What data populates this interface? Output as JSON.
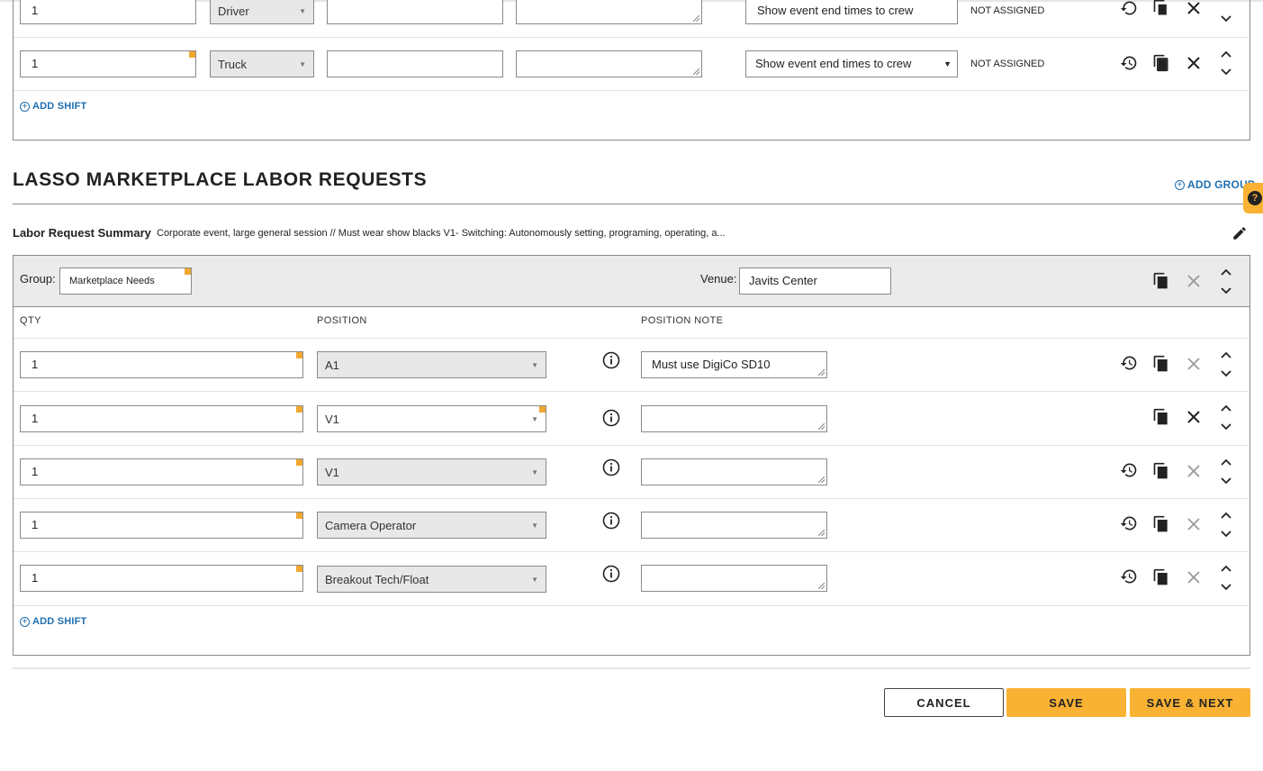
{
  "top_section": {
    "rows": [
      {
        "qty": "1",
        "position": "Driver",
        "notify_option": "Show event end times to crew",
        "status": "NOT ASSIGNED"
      },
      {
        "qty": "1",
        "position": "Truck",
        "notify_option": "Show event end times to crew",
        "status": "NOT ASSIGNED"
      }
    ],
    "add_shift_label": "ADD SHIFT"
  },
  "marketplace": {
    "title": "LASSO MARKETPLACE LABOR REQUESTS",
    "add_group_label": "ADD GROUP",
    "summary_label": "Labor Request Summary",
    "summary_text": "Corporate event, large general session // Must wear show blacks V1- Switching: Autonomously setting, programing, operating, a...",
    "group_label": "Group:",
    "group_value": "Marketplace Needs",
    "venue_label": "Venue:",
    "venue_value": "Javits Center",
    "columns": {
      "qty": "QTY",
      "position": "POSITION",
      "position_note": "POSITION NOTE"
    },
    "rows": [
      {
        "qty": "1",
        "position": "A1",
        "note": "Must use DigiCo SD10"
      },
      {
        "qty": "1",
        "position": "V1",
        "note": ""
      },
      {
        "qty": "1",
        "position": "V1",
        "note": ""
      },
      {
        "qty": "1",
        "position": "Camera Operator",
        "note": ""
      },
      {
        "qty": "1",
        "position": "Breakout Tech/Float",
        "note": ""
      }
    ],
    "add_shift_label": "ADD SHIFT"
  },
  "footer": {
    "cancel_label": "CANCEL",
    "save_label": "SAVE",
    "save_next_label": "SAVE & NEXT"
  },
  "help_widget": {
    "label": "?"
  },
  "colors": {
    "accent": "#f9b234",
    "link": "#1f6fb0",
    "required_marker": "#f0a830",
    "group_bar": "#ebebeb"
  },
  "icons": [
    "history-icon",
    "copy-icon",
    "close-icon",
    "chevron-up-icon",
    "chevron-down-icon",
    "info-icon",
    "pencil-icon",
    "plus-circle-icon",
    "help-chat-icon"
  ]
}
